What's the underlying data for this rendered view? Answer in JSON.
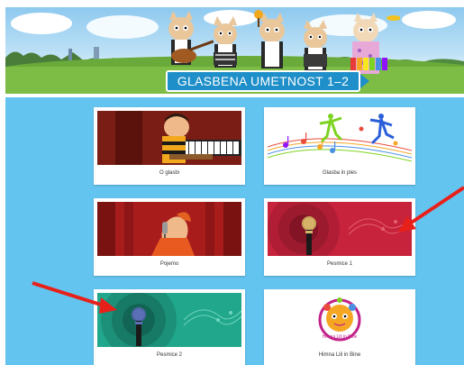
{
  "banner": {
    "title": "GLASBENA UMETNOST 1–2"
  },
  "cards": [
    {
      "label": "O glasbi"
    },
    {
      "label": "Glasba in ples"
    },
    {
      "label": "Pojemo"
    },
    {
      "label": "Pesmice 1"
    },
    {
      "label": "Pesmice 2"
    },
    {
      "label": "Himna Lili in Bine"
    }
  ],
  "logo_text": "Himna Lili in Bine",
  "colors": {
    "page_background": "#63c4ef",
    "banner_title_bg": "#1f8fc9",
    "annotation_arrow": "#e8201a"
  },
  "icons": [
    "microphone-icon",
    "annotation-arrow-icon"
  ]
}
